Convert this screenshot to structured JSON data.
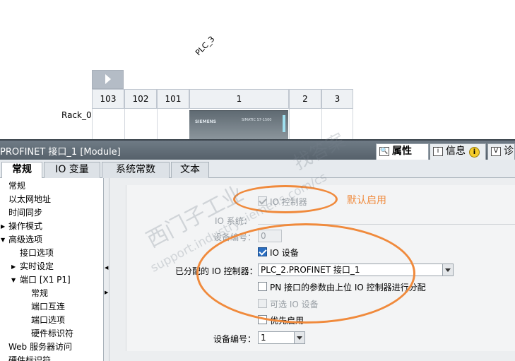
{
  "device_view": {
    "plc_label": "PLC_3",
    "rack_label": "Rack_0",
    "slots": [
      "103",
      "102",
      "101",
      "1",
      "2",
      "3"
    ],
    "module_brand": "SIEMENS",
    "module_model": "SIMATIC S7-1500"
  },
  "title_bar": {
    "title": "PROFINET 接口_1 [Module]",
    "tabs": [
      {
        "label": "属性",
        "icon": "properties-icon",
        "active": true
      },
      {
        "label": "信息",
        "icon": "info-icon",
        "active": false
      },
      {
        "label": "诊",
        "icon": "diagnostics-icon",
        "active": false
      }
    ]
  },
  "sub_tabs": [
    {
      "label": "常规",
      "active": true
    },
    {
      "label": "IO 变量",
      "active": false
    },
    {
      "label": "系统常数",
      "active": false
    },
    {
      "label": "文本",
      "active": false
    }
  ],
  "nav_tree": [
    {
      "label": "常规",
      "level": 0
    },
    {
      "label": "以太网地址",
      "level": 0
    },
    {
      "label": "时间同步",
      "level": 0
    },
    {
      "label": "操作模式",
      "level": 0,
      "selected": true
    },
    {
      "label": "高级选项",
      "level": 0,
      "expanded": true
    },
    {
      "label": "接口选项",
      "level": 1
    },
    {
      "label": "实时设定",
      "level": 1,
      "collapsed": true
    },
    {
      "label": "端口 [X1 P1]",
      "level": 1,
      "expanded": true
    },
    {
      "label": "常规",
      "level": 2
    },
    {
      "label": "端口互连",
      "level": 2
    },
    {
      "label": "端口选项",
      "level": 2
    },
    {
      "label": "硬件标识符",
      "level": 2
    },
    {
      "label": "Web 服务器访问",
      "level": 0
    },
    {
      "label": "硬件标识符",
      "level": 0
    }
  ],
  "form": {
    "io_controller_label": "IO 控制器",
    "io_system_label": "IO 系统：",
    "device_number_label": "设备编号：",
    "device_number_value": "0",
    "io_device_label": "IO 设备",
    "assigned_controller_label": "已分配的 IO 控制器：",
    "assigned_controller_value": "PLC_2.PROFINET 接口_1",
    "pn_param_label": "PN 接口的参数由上位 IO 控制器进行分配",
    "optional_device_label": "可选 IO 设备",
    "priority_startup_label": "优先启用",
    "device_number2_label": "设备编号：",
    "device_number2_value": "1"
  },
  "annotation": {
    "text": "默认启用",
    "color": "#f08a3c"
  },
  "watermark": {
    "line1": "西门子工业",
    "line2": "support.industry.siemens.com/cs",
    "line3": "找答案"
  }
}
